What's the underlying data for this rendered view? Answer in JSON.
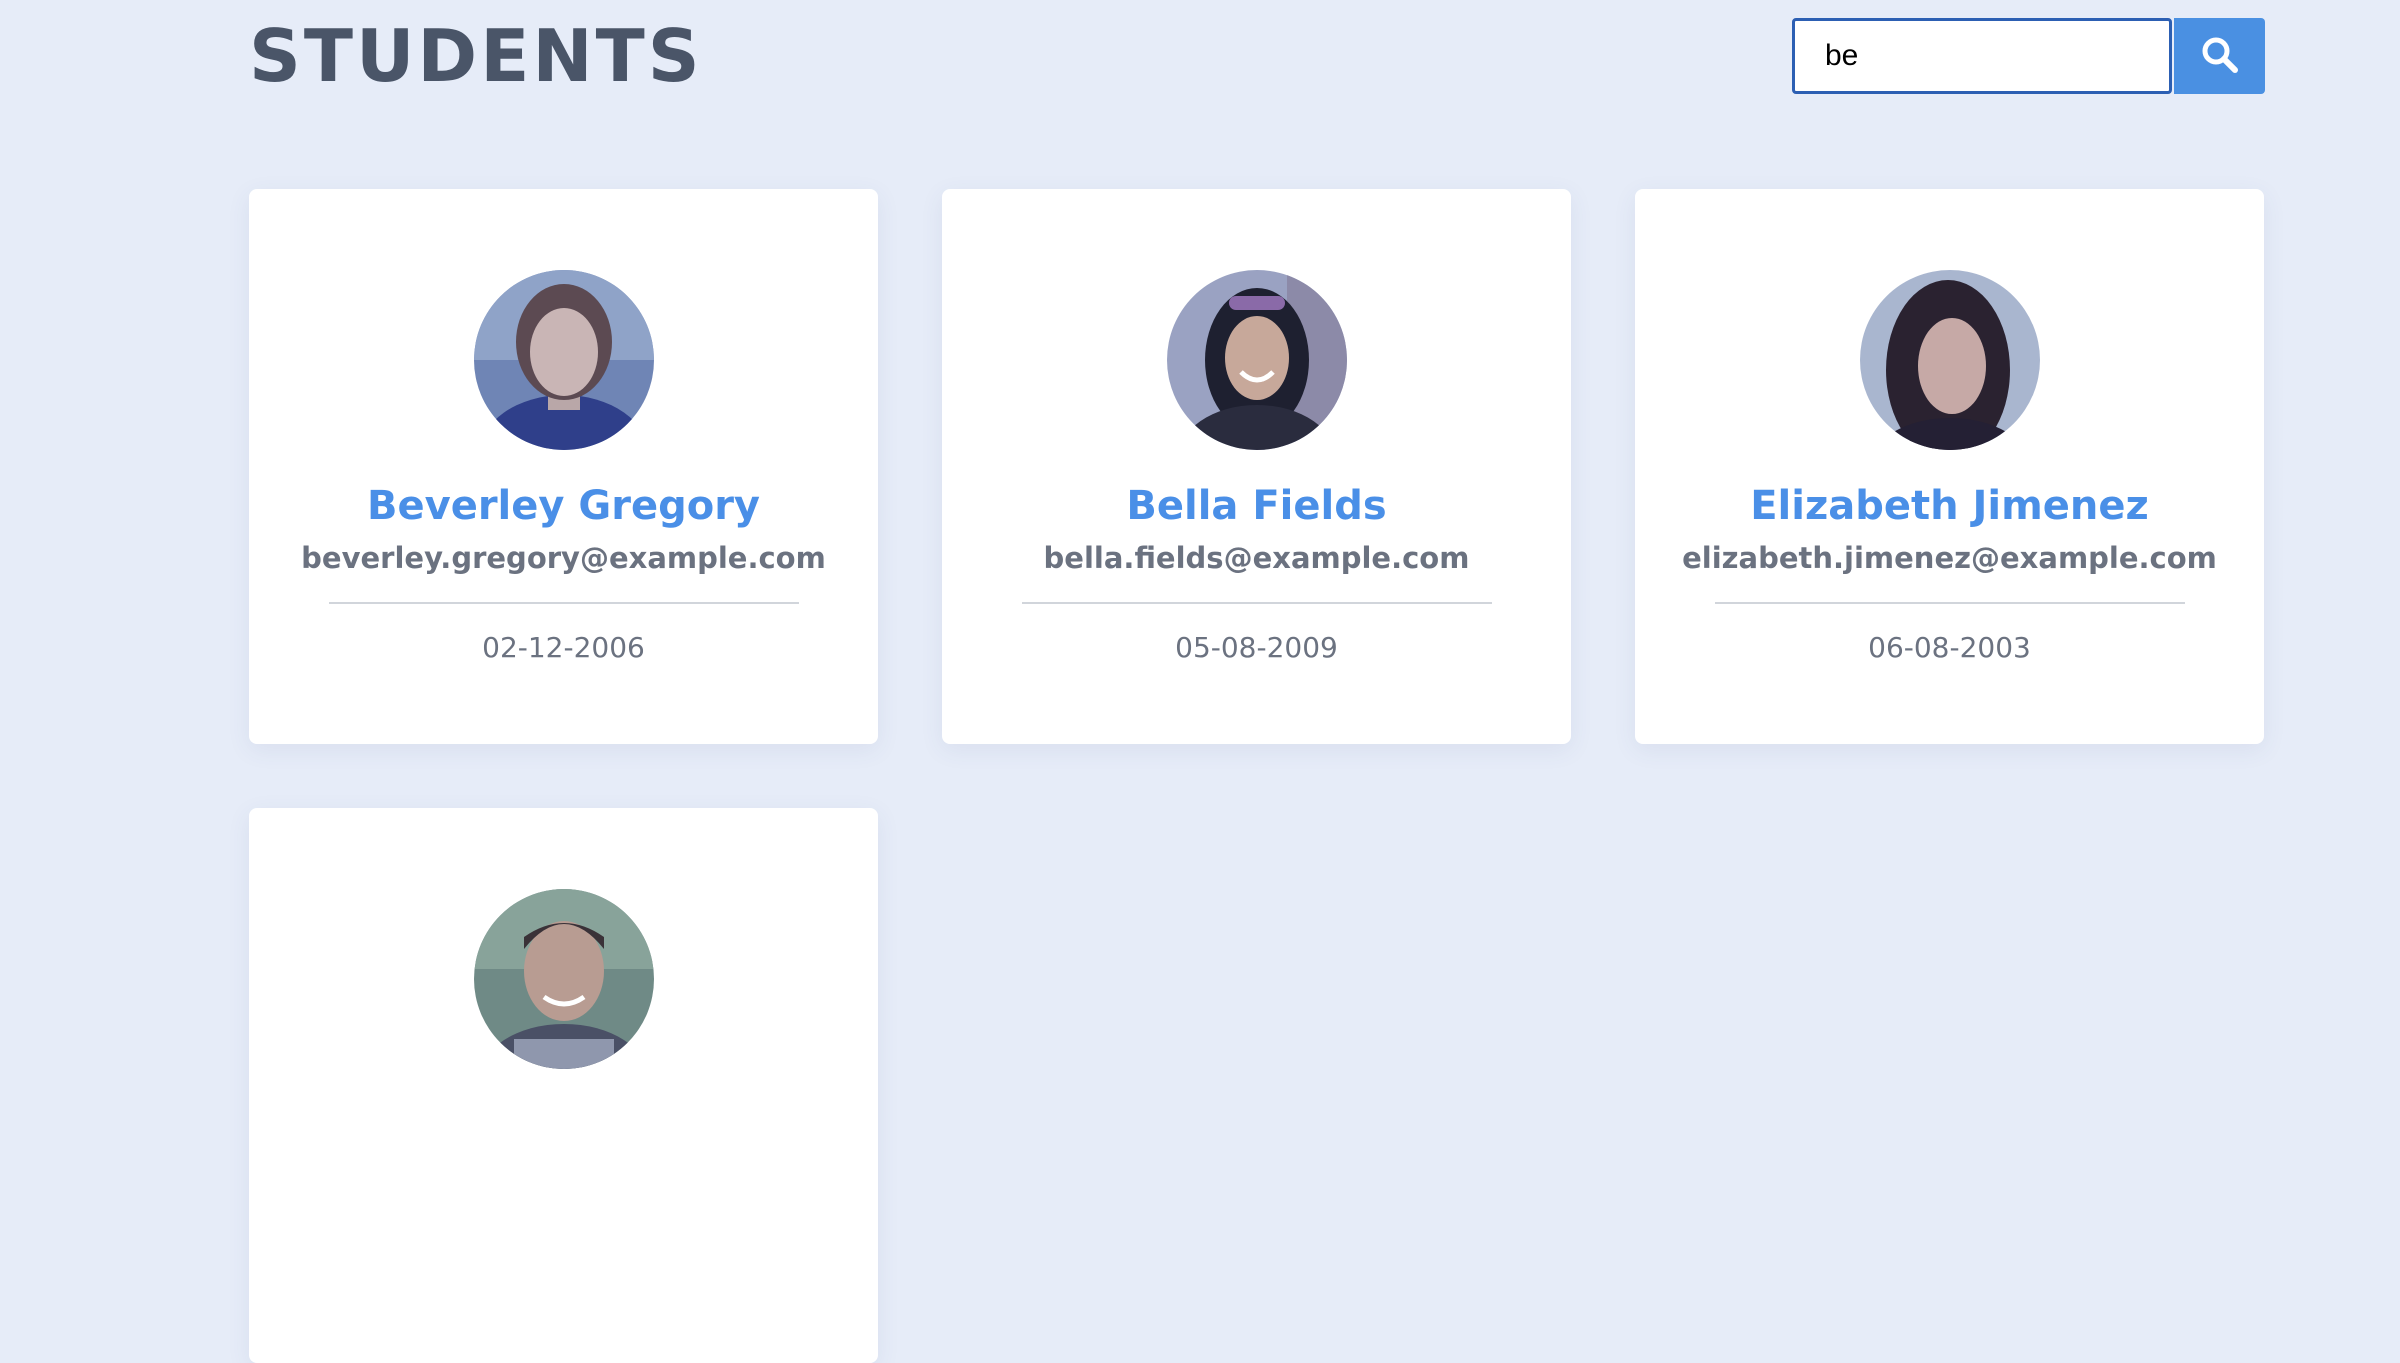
{
  "header": {
    "title": "STUDENTS",
    "search_value": "be",
    "search_icon": "search-icon"
  },
  "students": [
    {
      "name": "Beverley Gregory",
      "email": "beverley.gregory@example.com",
      "dob": "02-12-2006",
      "avatar_icon": "avatar-photo"
    },
    {
      "name": "Bella Fields",
      "email": "bella.fields@example.com",
      "dob": "05-08-2009",
      "avatar_icon": "avatar-photo"
    },
    {
      "name": "Elizabeth Jimenez",
      "email": "elizabeth.jimenez@example.com",
      "dob": "06-08-2003",
      "avatar_icon": "avatar-photo"
    },
    {
      "name": "",
      "email": "",
      "dob": "",
      "avatar_icon": "avatar-photo"
    }
  ],
  "colors": {
    "background": "#e6ecf8",
    "accent": "#4a90e2",
    "name": "#4a8fe7",
    "title": "#4a5568"
  }
}
